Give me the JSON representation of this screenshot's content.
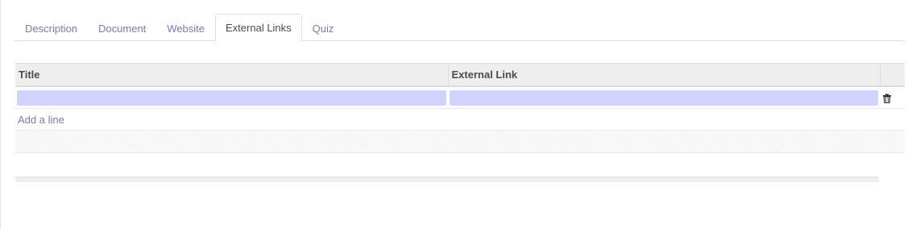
{
  "tabs": [
    {
      "label": "Description",
      "active": false
    },
    {
      "label": "Document",
      "active": false
    },
    {
      "label": "Website",
      "active": false
    },
    {
      "label": "External Links",
      "active": true
    },
    {
      "label": "Quiz",
      "active": false
    }
  ],
  "table": {
    "columns": [
      "Title",
      "External Link"
    ],
    "rows": [
      {
        "title": "",
        "external_link": ""
      }
    ],
    "add_line_label": "Add a line"
  },
  "colors": {
    "accent": "#7c7bad",
    "input_bg": "#d2d2ff",
    "header_bg": "#eeeeee"
  },
  "icons": {
    "delete": "trash-icon"
  }
}
